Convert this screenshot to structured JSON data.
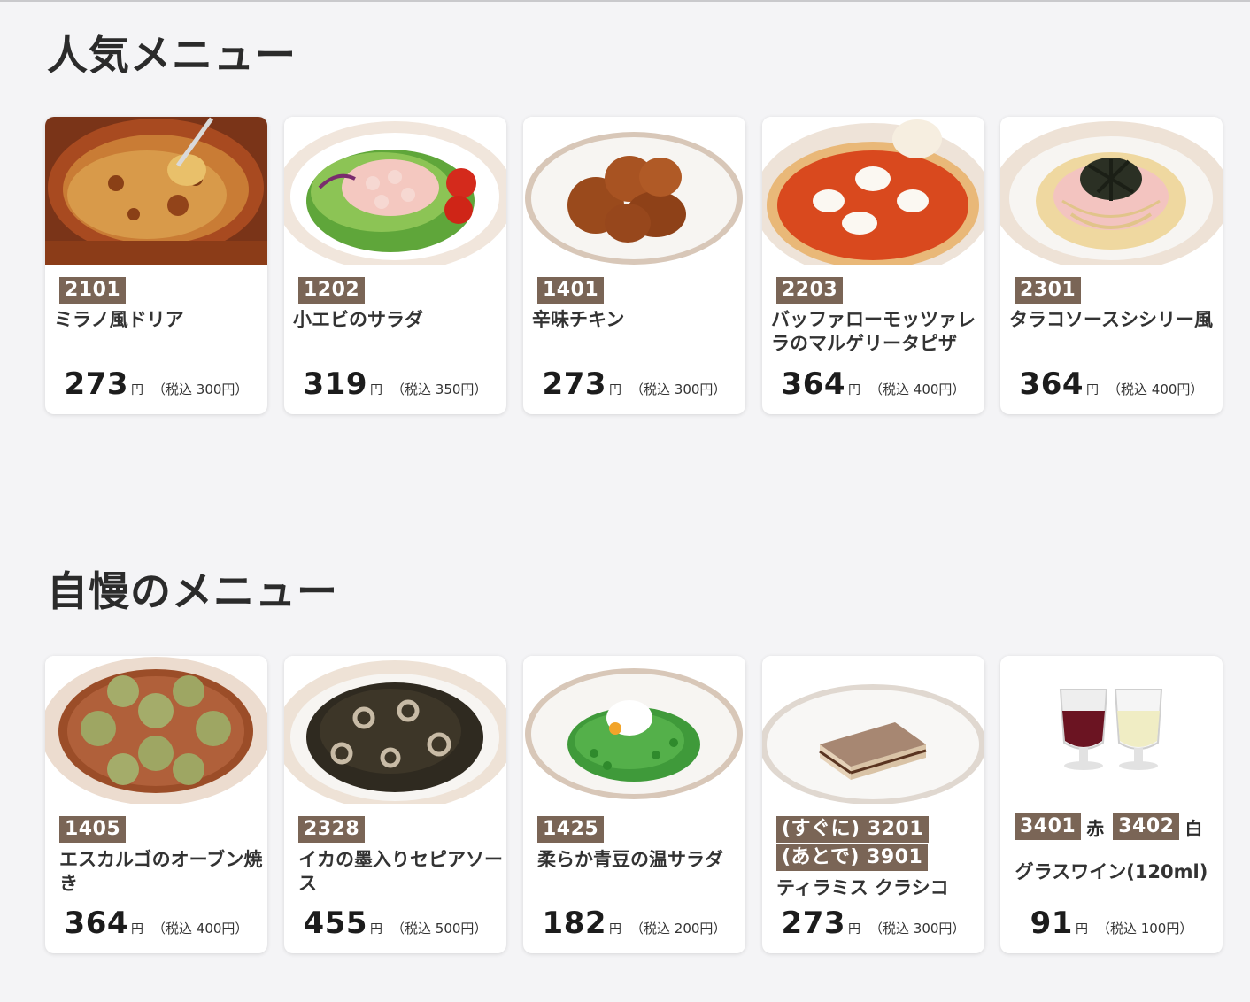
{
  "sections": [
    {
      "title": "人気メニュー",
      "items": [
        {
          "code": "2101",
          "name": "ミラノ風ドリア",
          "price": "273",
          "yen": "円",
          "tax": "（税込 300円）"
        },
        {
          "code": "1202",
          "name": "小エビのサラダ",
          "price": "319",
          "yen": "円",
          "tax": "（税込 350円）"
        },
        {
          "code": "1401",
          "name": "辛味チキン",
          "price": "273",
          "yen": "円",
          "tax": "（税込 300円）"
        },
        {
          "code": "2203",
          "name": "バッファローモッツァレラのマルゲリータピザ",
          "price": "364",
          "yen": "円",
          "tax": "（税込 400円）"
        },
        {
          "code": "2301",
          "name": "タラコソースシシリー風",
          "price": "364",
          "yen": "円",
          "tax": "（税込 400円）"
        }
      ]
    },
    {
      "title": "自慢のメニュー",
      "items": [
        {
          "code": "1405",
          "name": "エスカルゴのオーブン焼き",
          "price": "364",
          "yen": "円",
          "tax": "（税込 400円）"
        },
        {
          "code": "2328",
          "name": "イカの墨入りセピアソース",
          "price": "455",
          "yen": "円",
          "tax": "（税込 500円）"
        },
        {
          "code": "1425",
          "name": "柔らか青豆の温サラダ",
          "price": "182",
          "yen": "円",
          "tax": "（税込 200円）"
        },
        {
          "code": "(すぐに) 3201",
          "code2": "(あとで) 3901",
          "name": "ティラミス クラシコ",
          "price": "273",
          "yen": "円",
          "tax": "（税込 300円）"
        },
        {
          "code": "3401",
          "code_suffix": "赤",
          "code_b": "3402",
          "code_b_suffix": "白",
          "name": "グラスワイン(120ml)",
          "price": "91",
          "yen": "円",
          "tax": "（税込 100円）"
        }
      ]
    }
  ]
}
